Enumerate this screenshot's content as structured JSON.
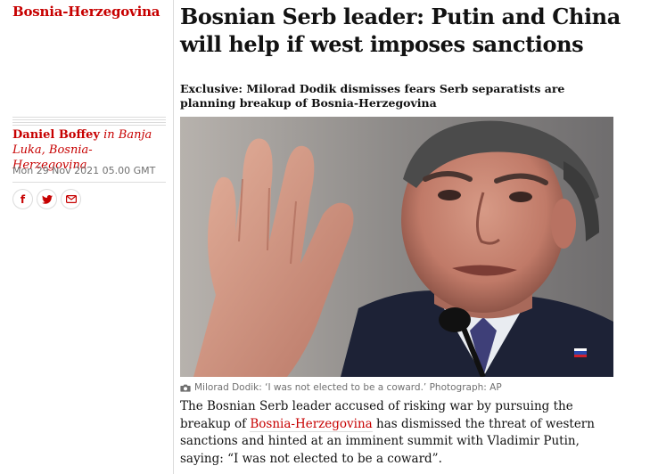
{
  "section": {
    "label": "Bosnia-Herzegovina"
  },
  "article": {
    "headline": "Bosnian Serb leader: Putin and China will help if west imposes sanctions",
    "standfirst": "Exclusive: Milorad Dodik dismisses fears Serb separatists are planning breakup of Bosnia-Herzegovina",
    "author": "Daniel Boffey",
    "location_prefix": " in ",
    "location": "Banja Luka, Bosnia-Herzegovina",
    "date": "Mon 29 Nov 2021 05.00 GMT",
    "caption": "Milorad Dodik: ‘I was not elected to be a coward.’ Photograph: AP",
    "body_part1": "The Bosnian Serb leader accused of risking war by pursuing the breakup of ",
    "body_link": "Bosnia-Herzegovina",
    "body_part2": " has dismissed the threat of western sanctions and hinted at an imminent summit with Vladimir Putin, saying: “I was not elected to be a coward”."
  },
  "share": {
    "facebook_icon": "f",
    "twitter_icon": "twitter-bird",
    "email_icon": "envelope"
  },
  "colors": {
    "accent": "#c70000",
    "text": "#121212",
    "muted": "#707070",
    "rule": "#dcdcdc"
  }
}
